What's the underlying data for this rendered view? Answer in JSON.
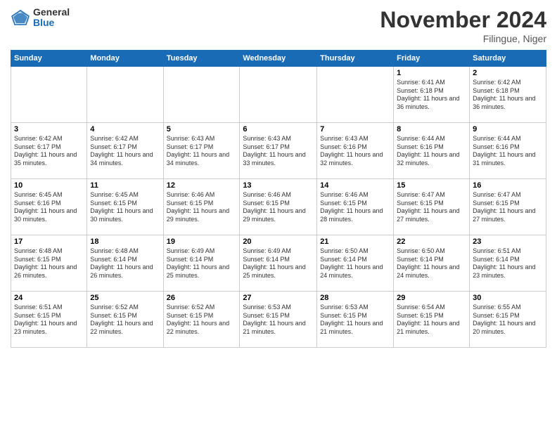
{
  "logo": {
    "general": "General",
    "blue": "Blue"
  },
  "title": "November 2024",
  "location": "Filingue, Niger",
  "days_of_week": [
    "Sunday",
    "Monday",
    "Tuesday",
    "Wednesday",
    "Thursday",
    "Friday",
    "Saturday"
  ],
  "weeks": [
    [
      {
        "day": "",
        "info": ""
      },
      {
        "day": "",
        "info": ""
      },
      {
        "day": "",
        "info": ""
      },
      {
        "day": "",
        "info": ""
      },
      {
        "day": "",
        "info": ""
      },
      {
        "day": "1",
        "info": "Sunrise: 6:41 AM\nSunset: 6:18 PM\nDaylight: 11 hours and 36 minutes."
      },
      {
        "day": "2",
        "info": "Sunrise: 6:42 AM\nSunset: 6:18 PM\nDaylight: 11 hours and 36 minutes."
      }
    ],
    [
      {
        "day": "3",
        "info": "Sunrise: 6:42 AM\nSunset: 6:17 PM\nDaylight: 11 hours and 35 minutes."
      },
      {
        "day": "4",
        "info": "Sunrise: 6:42 AM\nSunset: 6:17 PM\nDaylight: 11 hours and 34 minutes."
      },
      {
        "day": "5",
        "info": "Sunrise: 6:43 AM\nSunset: 6:17 PM\nDaylight: 11 hours and 34 minutes."
      },
      {
        "day": "6",
        "info": "Sunrise: 6:43 AM\nSunset: 6:17 PM\nDaylight: 11 hours and 33 minutes."
      },
      {
        "day": "7",
        "info": "Sunrise: 6:43 AM\nSunset: 6:16 PM\nDaylight: 11 hours and 32 minutes."
      },
      {
        "day": "8",
        "info": "Sunrise: 6:44 AM\nSunset: 6:16 PM\nDaylight: 11 hours and 32 minutes."
      },
      {
        "day": "9",
        "info": "Sunrise: 6:44 AM\nSunset: 6:16 PM\nDaylight: 11 hours and 31 minutes."
      }
    ],
    [
      {
        "day": "10",
        "info": "Sunrise: 6:45 AM\nSunset: 6:16 PM\nDaylight: 11 hours and 30 minutes."
      },
      {
        "day": "11",
        "info": "Sunrise: 6:45 AM\nSunset: 6:15 PM\nDaylight: 11 hours and 30 minutes."
      },
      {
        "day": "12",
        "info": "Sunrise: 6:46 AM\nSunset: 6:15 PM\nDaylight: 11 hours and 29 minutes."
      },
      {
        "day": "13",
        "info": "Sunrise: 6:46 AM\nSunset: 6:15 PM\nDaylight: 11 hours and 29 minutes."
      },
      {
        "day": "14",
        "info": "Sunrise: 6:46 AM\nSunset: 6:15 PM\nDaylight: 11 hours and 28 minutes."
      },
      {
        "day": "15",
        "info": "Sunrise: 6:47 AM\nSunset: 6:15 PM\nDaylight: 11 hours and 27 minutes."
      },
      {
        "day": "16",
        "info": "Sunrise: 6:47 AM\nSunset: 6:15 PM\nDaylight: 11 hours and 27 minutes."
      }
    ],
    [
      {
        "day": "17",
        "info": "Sunrise: 6:48 AM\nSunset: 6:15 PM\nDaylight: 11 hours and 26 minutes."
      },
      {
        "day": "18",
        "info": "Sunrise: 6:48 AM\nSunset: 6:14 PM\nDaylight: 11 hours and 26 minutes."
      },
      {
        "day": "19",
        "info": "Sunrise: 6:49 AM\nSunset: 6:14 PM\nDaylight: 11 hours and 25 minutes."
      },
      {
        "day": "20",
        "info": "Sunrise: 6:49 AM\nSunset: 6:14 PM\nDaylight: 11 hours and 25 minutes."
      },
      {
        "day": "21",
        "info": "Sunrise: 6:50 AM\nSunset: 6:14 PM\nDaylight: 11 hours and 24 minutes."
      },
      {
        "day": "22",
        "info": "Sunrise: 6:50 AM\nSunset: 6:14 PM\nDaylight: 11 hours and 24 minutes."
      },
      {
        "day": "23",
        "info": "Sunrise: 6:51 AM\nSunset: 6:14 PM\nDaylight: 11 hours and 23 minutes."
      }
    ],
    [
      {
        "day": "24",
        "info": "Sunrise: 6:51 AM\nSunset: 6:15 PM\nDaylight: 11 hours and 23 minutes."
      },
      {
        "day": "25",
        "info": "Sunrise: 6:52 AM\nSunset: 6:15 PM\nDaylight: 11 hours and 22 minutes."
      },
      {
        "day": "26",
        "info": "Sunrise: 6:52 AM\nSunset: 6:15 PM\nDaylight: 11 hours and 22 minutes."
      },
      {
        "day": "27",
        "info": "Sunrise: 6:53 AM\nSunset: 6:15 PM\nDaylight: 11 hours and 21 minutes."
      },
      {
        "day": "28",
        "info": "Sunrise: 6:53 AM\nSunset: 6:15 PM\nDaylight: 11 hours and 21 minutes."
      },
      {
        "day": "29",
        "info": "Sunrise: 6:54 AM\nSunset: 6:15 PM\nDaylight: 11 hours and 21 minutes."
      },
      {
        "day": "30",
        "info": "Sunrise: 6:55 AM\nSunset: 6:15 PM\nDaylight: 11 hours and 20 minutes."
      }
    ]
  ]
}
